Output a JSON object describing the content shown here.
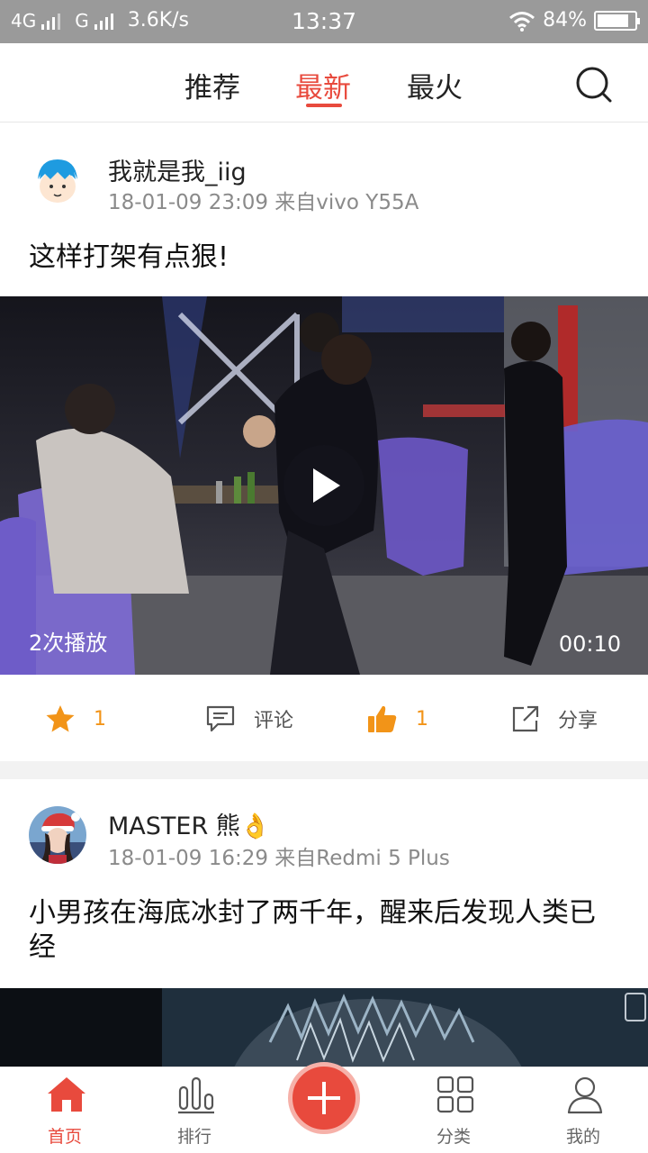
{
  "status_bar": {
    "network_1": "4G",
    "network_2": "G",
    "speed": "3.6K/s",
    "time": "13:37",
    "battery": "84%",
    "battery_level": 0.84
  },
  "top_tabs": [
    {
      "label": "推荐",
      "active": false
    },
    {
      "label": "最新",
      "active": true
    },
    {
      "label": "最火",
      "active": false
    }
  ],
  "posts": [
    {
      "username": "我就是我_iig",
      "meta": "18-01-09 23:09 来自vivo Y55A",
      "caption": "这样打架有点狠!",
      "plays": "2次播放",
      "duration": "00:10",
      "favorite_count": "1",
      "comment_label": "评论",
      "like_count": "1",
      "share_label": "分享"
    },
    {
      "username": "MASTER 熊👌",
      "meta": "18-01-09 16:29 来自Redmi 5 Plus",
      "caption": "小男孩在海底冰封了两千年，醒来后发现人类已经"
    }
  ],
  "bottom_nav": [
    {
      "label": "首页",
      "icon": "home-icon",
      "active": true
    },
    {
      "label": "排行",
      "icon": "ranking-icon",
      "active": false
    },
    {
      "label": "",
      "icon": "plus-icon",
      "active": false
    },
    {
      "label": "分类",
      "icon": "grid-icon",
      "active": false
    },
    {
      "label": "我的",
      "icon": "profile-icon",
      "active": false
    }
  ],
  "colors": {
    "accent": "#e84a3d",
    "count": "#f29418",
    "status_bar": "#9a9a9a"
  }
}
